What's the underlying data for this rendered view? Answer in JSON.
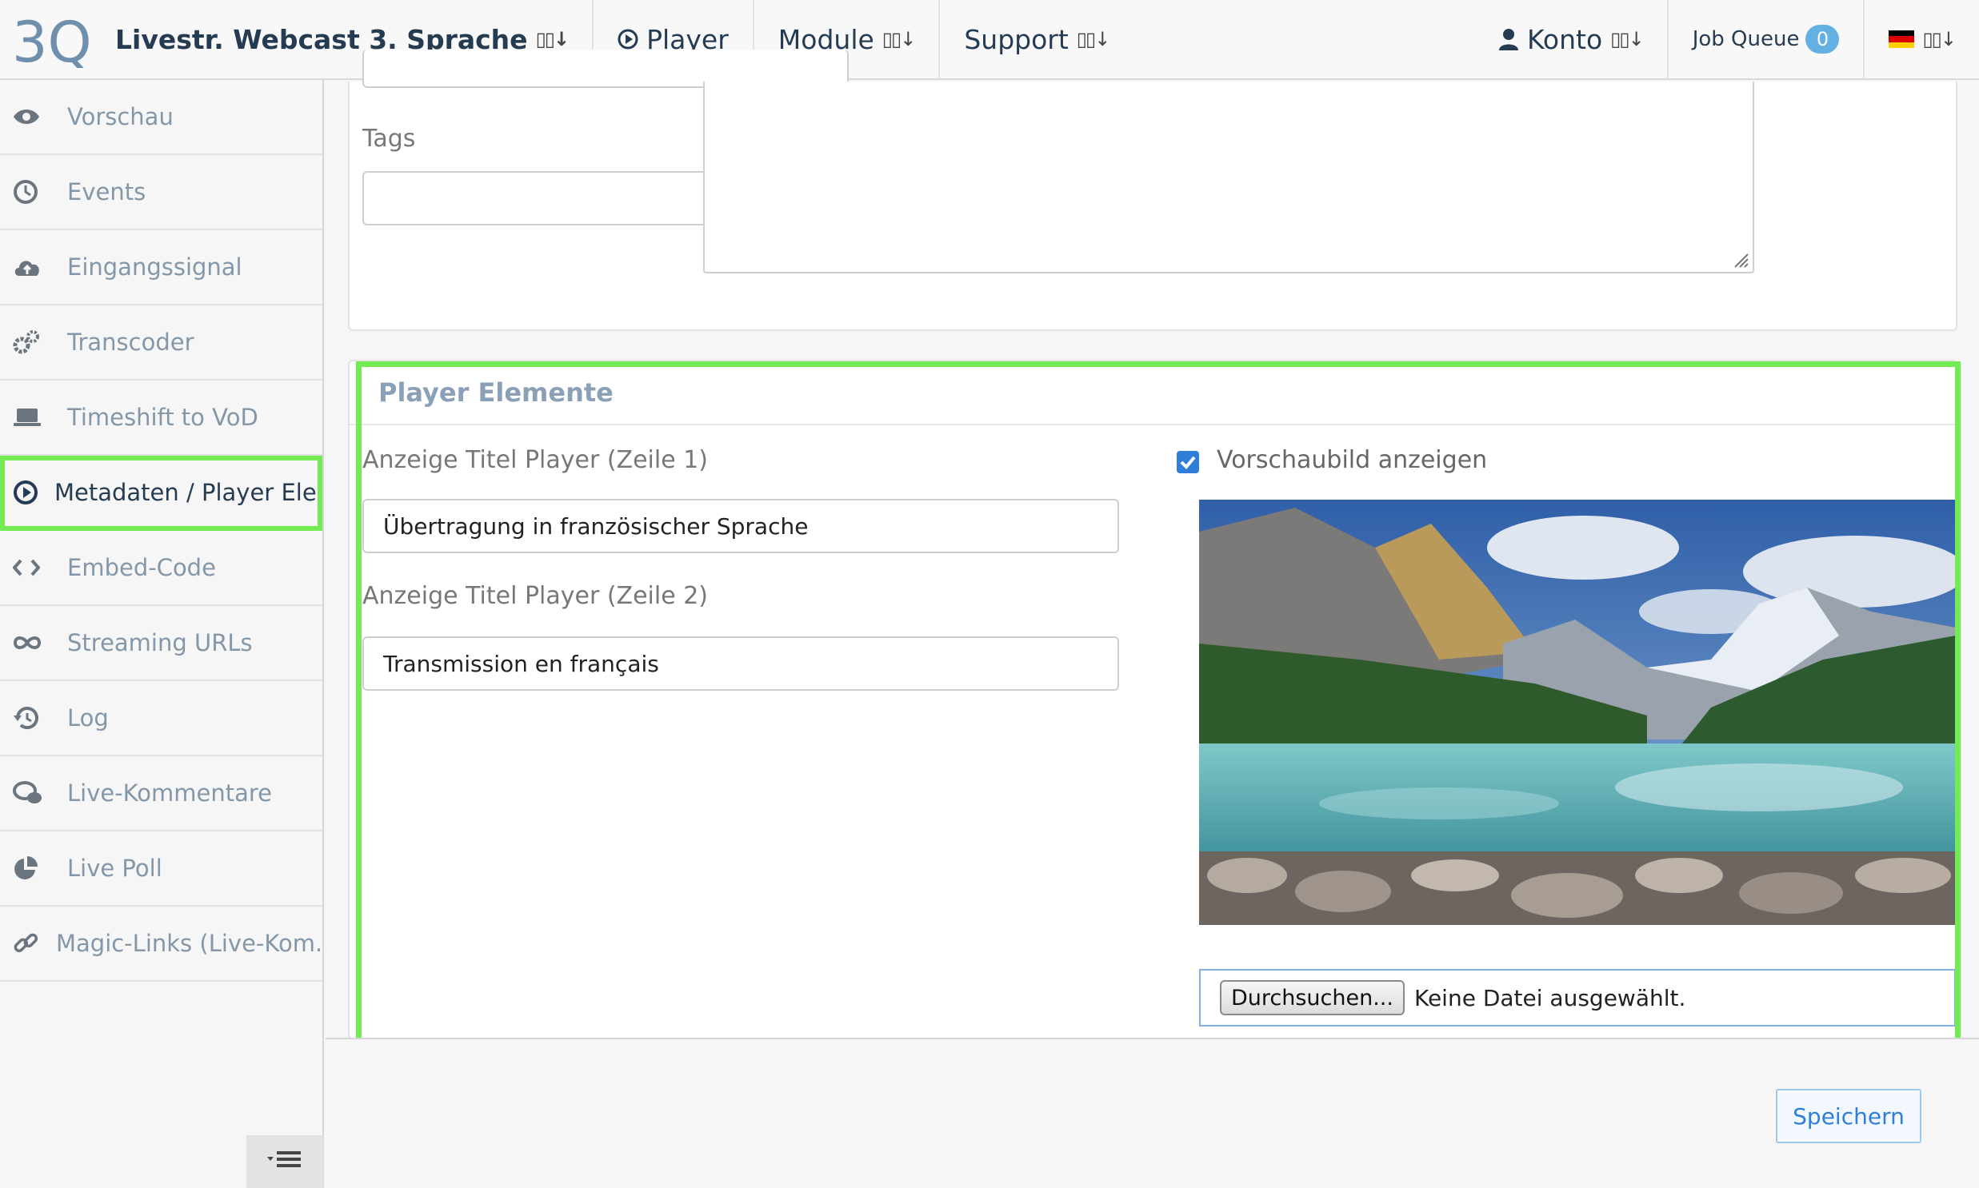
{
  "topnav": {
    "logo_text": "3Q",
    "brand_label": "Livestr. Webcast 3. Sprache",
    "player_label": "Player",
    "module_label": "Module",
    "support_label": "Support",
    "account_label": "Konto",
    "job_queue_label": "Job Queue",
    "job_queue_count": "0",
    "language_flag": "de-flag-icon",
    "sort_glyph": "↓"
  },
  "sidebar": {
    "items": [
      {
        "label": "Vorschau",
        "icon": "eye-icon"
      },
      {
        "label": "Events",
        "icon": "clock-icon"
      },
      {
        "label": "Eingangssignal",
        "icon": "cloud-upload-icon"
      },
      {
        "label": "Transcoder",
        "icon": "gears-icon"
      },
      {
        "label": "Timeshift to VoD",
        "icon": "laptop-icon"
      },
      {
        "label": "Metadaten / Player Ele..",
        "icon": "play-circle-icon"
      },
      {
        "label": "Embed-Code",
        "icon": "code-icon"
      },
      {
        "label": "Streaming URLs",
        "icon": "infinity-icon"
      },
      {
        "label": "Log",
        "icon": "history-icon"
      },
      {
        "label": "Live-Kommentare",
        "icon": "comments-icon"
      },
      {
        "label": "Live Poll",
        "icon": "pie-chart-icon"
      },
      {
        "label": "Magic-Links (Live-Kom...",
        "icon": "link-icon"
      }
    ],
    "active_index": 5
  },
  "form": {
    "tags_label": "Tags",
    "tags_value": "",
    "player_section_title": "Player Elemente",
    "title1_label": "Anzeige Titel Player (Zeile 1)",
    "title1_value": "Übertragung in französischer Sprache",
    "title2_label": "Anzeige Titel Player (Zeile 2)",
    "title2_value": "Transmission en français",
    "preview_checkbox_label": "Vorschaubild anzeigen",
    "preview_checked": true,
    "file_button_label": "Durchsuchen...",
    "file_status": "Keine Datei ausgewählt."
  },
  "footer": {
    "save_label": "Speichern"
  },
  "colors": {
    "highlight": "#74ea53",
    "accent": "#2f7fd9",
    "nav_text": "#253b52",
    "muted_text": "#8497a9"
  }
}
